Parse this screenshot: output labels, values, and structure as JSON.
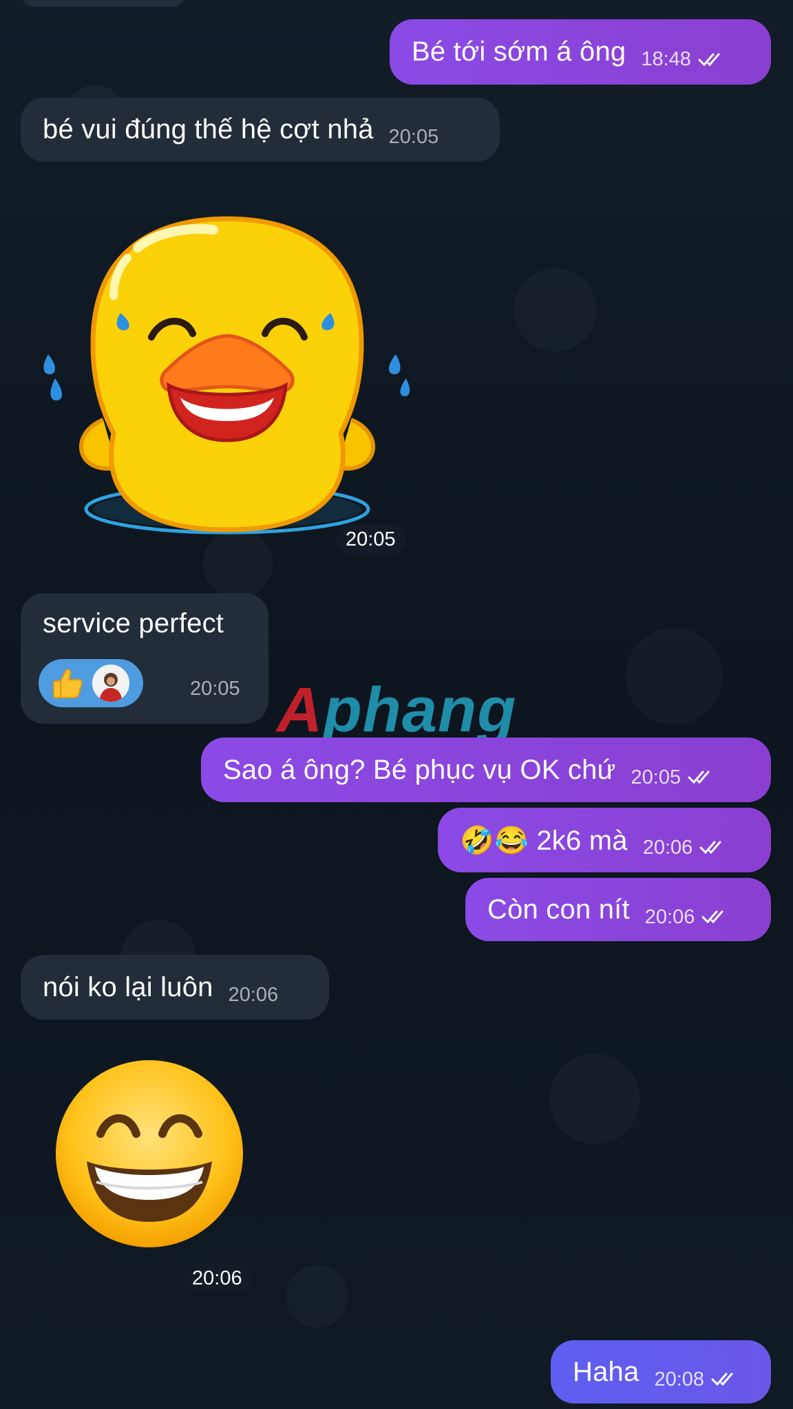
{
  "messages": [
    {
      "id": "m1",
      "text": "Bé tới sớm á ông",
      "time": "18:48"
    },
    {
      "id": "m2",
      "text": "bé vui đúng thế hệ cợt nhả",
      "time": "20:05"
    },
    {
      "id": "m3",
      "time": "20:05"
    },
    {
      "id": "m4",
      "text": "service perfect",
      "time": "20:05"
    },
    {
      "id": "m5",
      "text": "Sao á ông? Bé phục vụ OK chứ",
      "time": "20:05"
    },
    {
      "id": "m6",
      "text": "🤣😂 2k6 mà",
      "time": "20:06"
    },
    {
      "id": "m7",
      "text": "Còn con nít",
      "time": "20:06"
    },
    {
      "id": "m8",
      "text": "nói ko lại luôn",
      "time": "20:06"
    },
    {
      "id": "m9",
      "time": "20:06"
    },
    {
      "id": "m10",
      "text": "Haha",
      "time": "20:08"
    }
  ],
  "watermark": {
    "first": "A",
    "rest": "phang"
  },
  "colors": {
    "incoming": "#222d39",
    "outgoing": "#8a44dc",
    "outgoing_last": "#5f5ded",
    "reaction": "#4f9be0"
  },
  "icons": {
    "read": "double-check-icon",
    "reaction": "thumbs-up-icon"
  }
}
